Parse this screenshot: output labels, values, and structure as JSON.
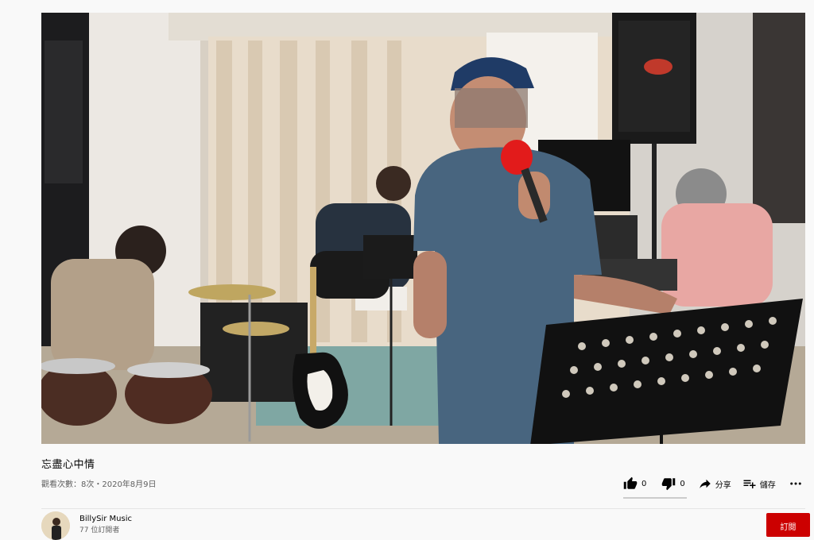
{
  "video": {
    "title": "忘盡心中情",
    "views_date": "觀看次數：8次・2020年8月9日"
  },
  "actions": {
    "like_count": "0",
    "dislike_count": "0",
    "share_label": "分享",
    "save_label": "儲存",
    "like_ratio": 0
  },
  "channel": {
    "name": "BillySir Music",
    "subscribers": "77 位訂閱者",
    "subscribe_label": "訂閱"
  },
  "icons": [
    "thumb-up-icon",
    "thumb-down-icon",
    "share-icon",
    "playlist-add-icon",
    "more-icon"
  ]
}
